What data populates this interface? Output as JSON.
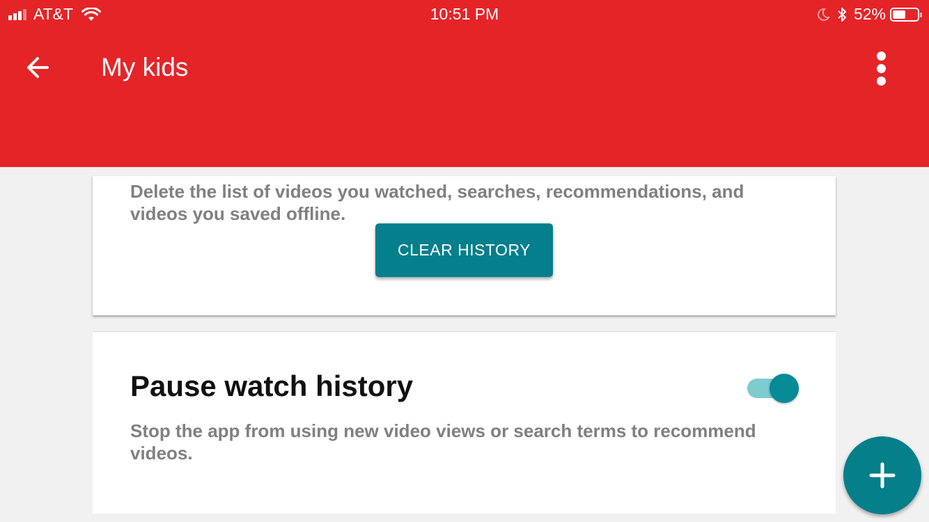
{
  "status_bar": {
    "carrier": "AT&T",
    "time": "10:51 PM",
    "battery_percent": "52%",
    "battery_level": 0.52,
    "signal_bars": 3,
    "icons": [
      "signal-icon",
      "wifi-icon",
      "moon-icon",
      "bluetooth-icon",
      "battery-icon"
    ]
  },
  "app_bar": {
    "title": "My kids",
    "back_icon": "arrow-left-icon",
    "menu_icon": "more-vert-icon",
    "color": "#e52428"
  },
  "history_card": {
    "description": "Delete the list of videos you watched, searches, recommendations, and videos you saved offline.",
    "clear_button_label": "CLEAR HISTORY",
    "button_color": "#047f8c"
  },
  "pause_card": {
    "title": "Pause watch history",
    "description": "Stop the app from using new video views or search terms to recommend videos.",
    "toggle_on": true
  },
  "fab": {
    "icon": "plus-icon",
    "color": "#057f8a"
  }
}
